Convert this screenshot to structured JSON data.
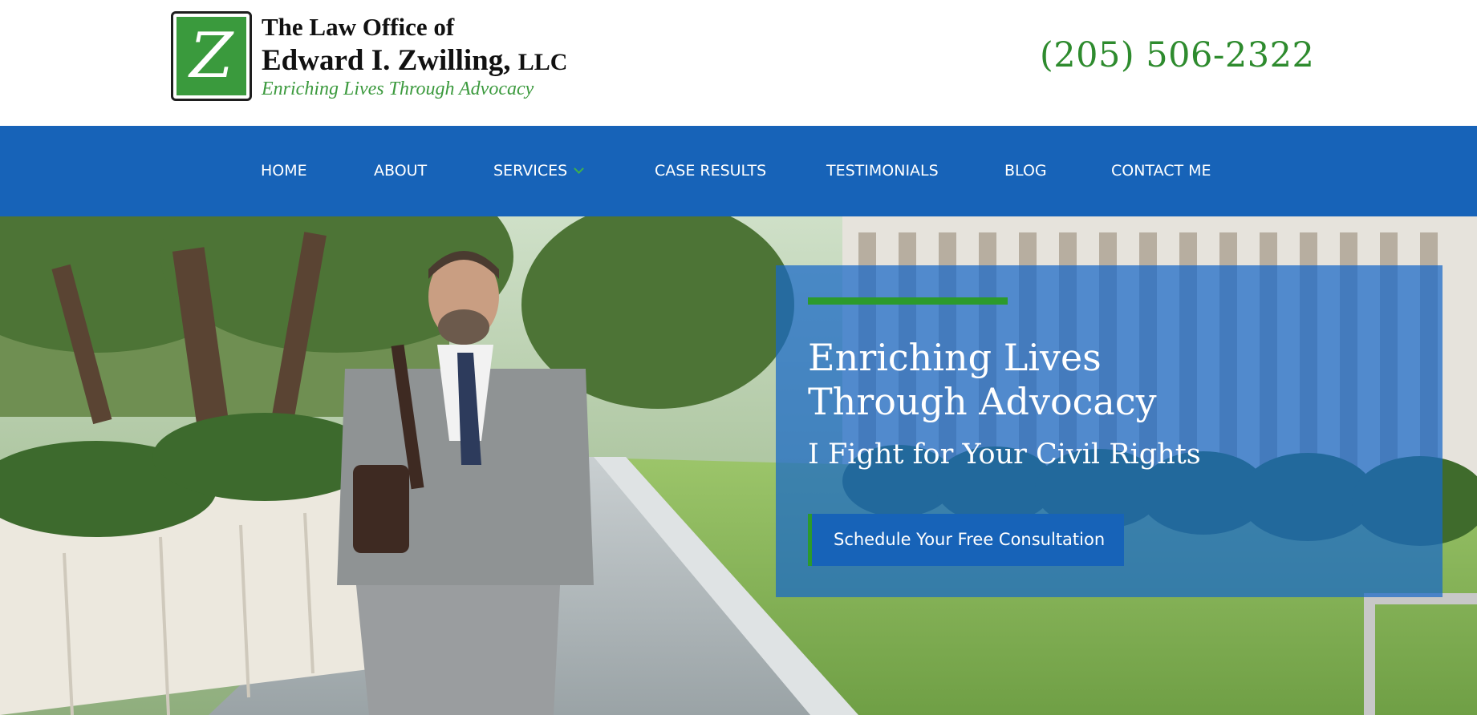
{
  "header": {
    "logo": {
      "letter": "Z",
      "line1": "The Law Office of",
      "line2_name": "Edward I. Zwilling,",
      "line2_suffix": "LLC",
      "tagline": "Enriching Lives Through Advocacy"
    },
    "phone": "(205) 506-2322"
  },
  "nav": {
    "items": [
      {
        "label": "HOME"
      },
      {
        "label": "ABOUT"
      },
      {
        "label": "SERVICES",
        "has_dropdown": true
      },
      {
        "label": "CASE RESULTS"
      },
      {
        "label": "TESTIMONIALS"
      },
      {
        "label": "BLOG"
      },
      {
        "label": "CONTACT ME"
      }
    ]
  },
  "hero": {
    "heading_line1": "Enriching Lives",
    "heading_line2": "Through Advocacy",
    "subheading": "I Fight for Your Civil Rights",
    "cta_label": "Schedule Your Free Consultation"
  },
  "colors": {
    "nav_blue": "#1763b8",
    "brand_green": "#2e8b2e",
    "card_blue": "#1868c8"
  },
  "icons": {
    "dropdown": "chevron-down-icon"
  }
}
